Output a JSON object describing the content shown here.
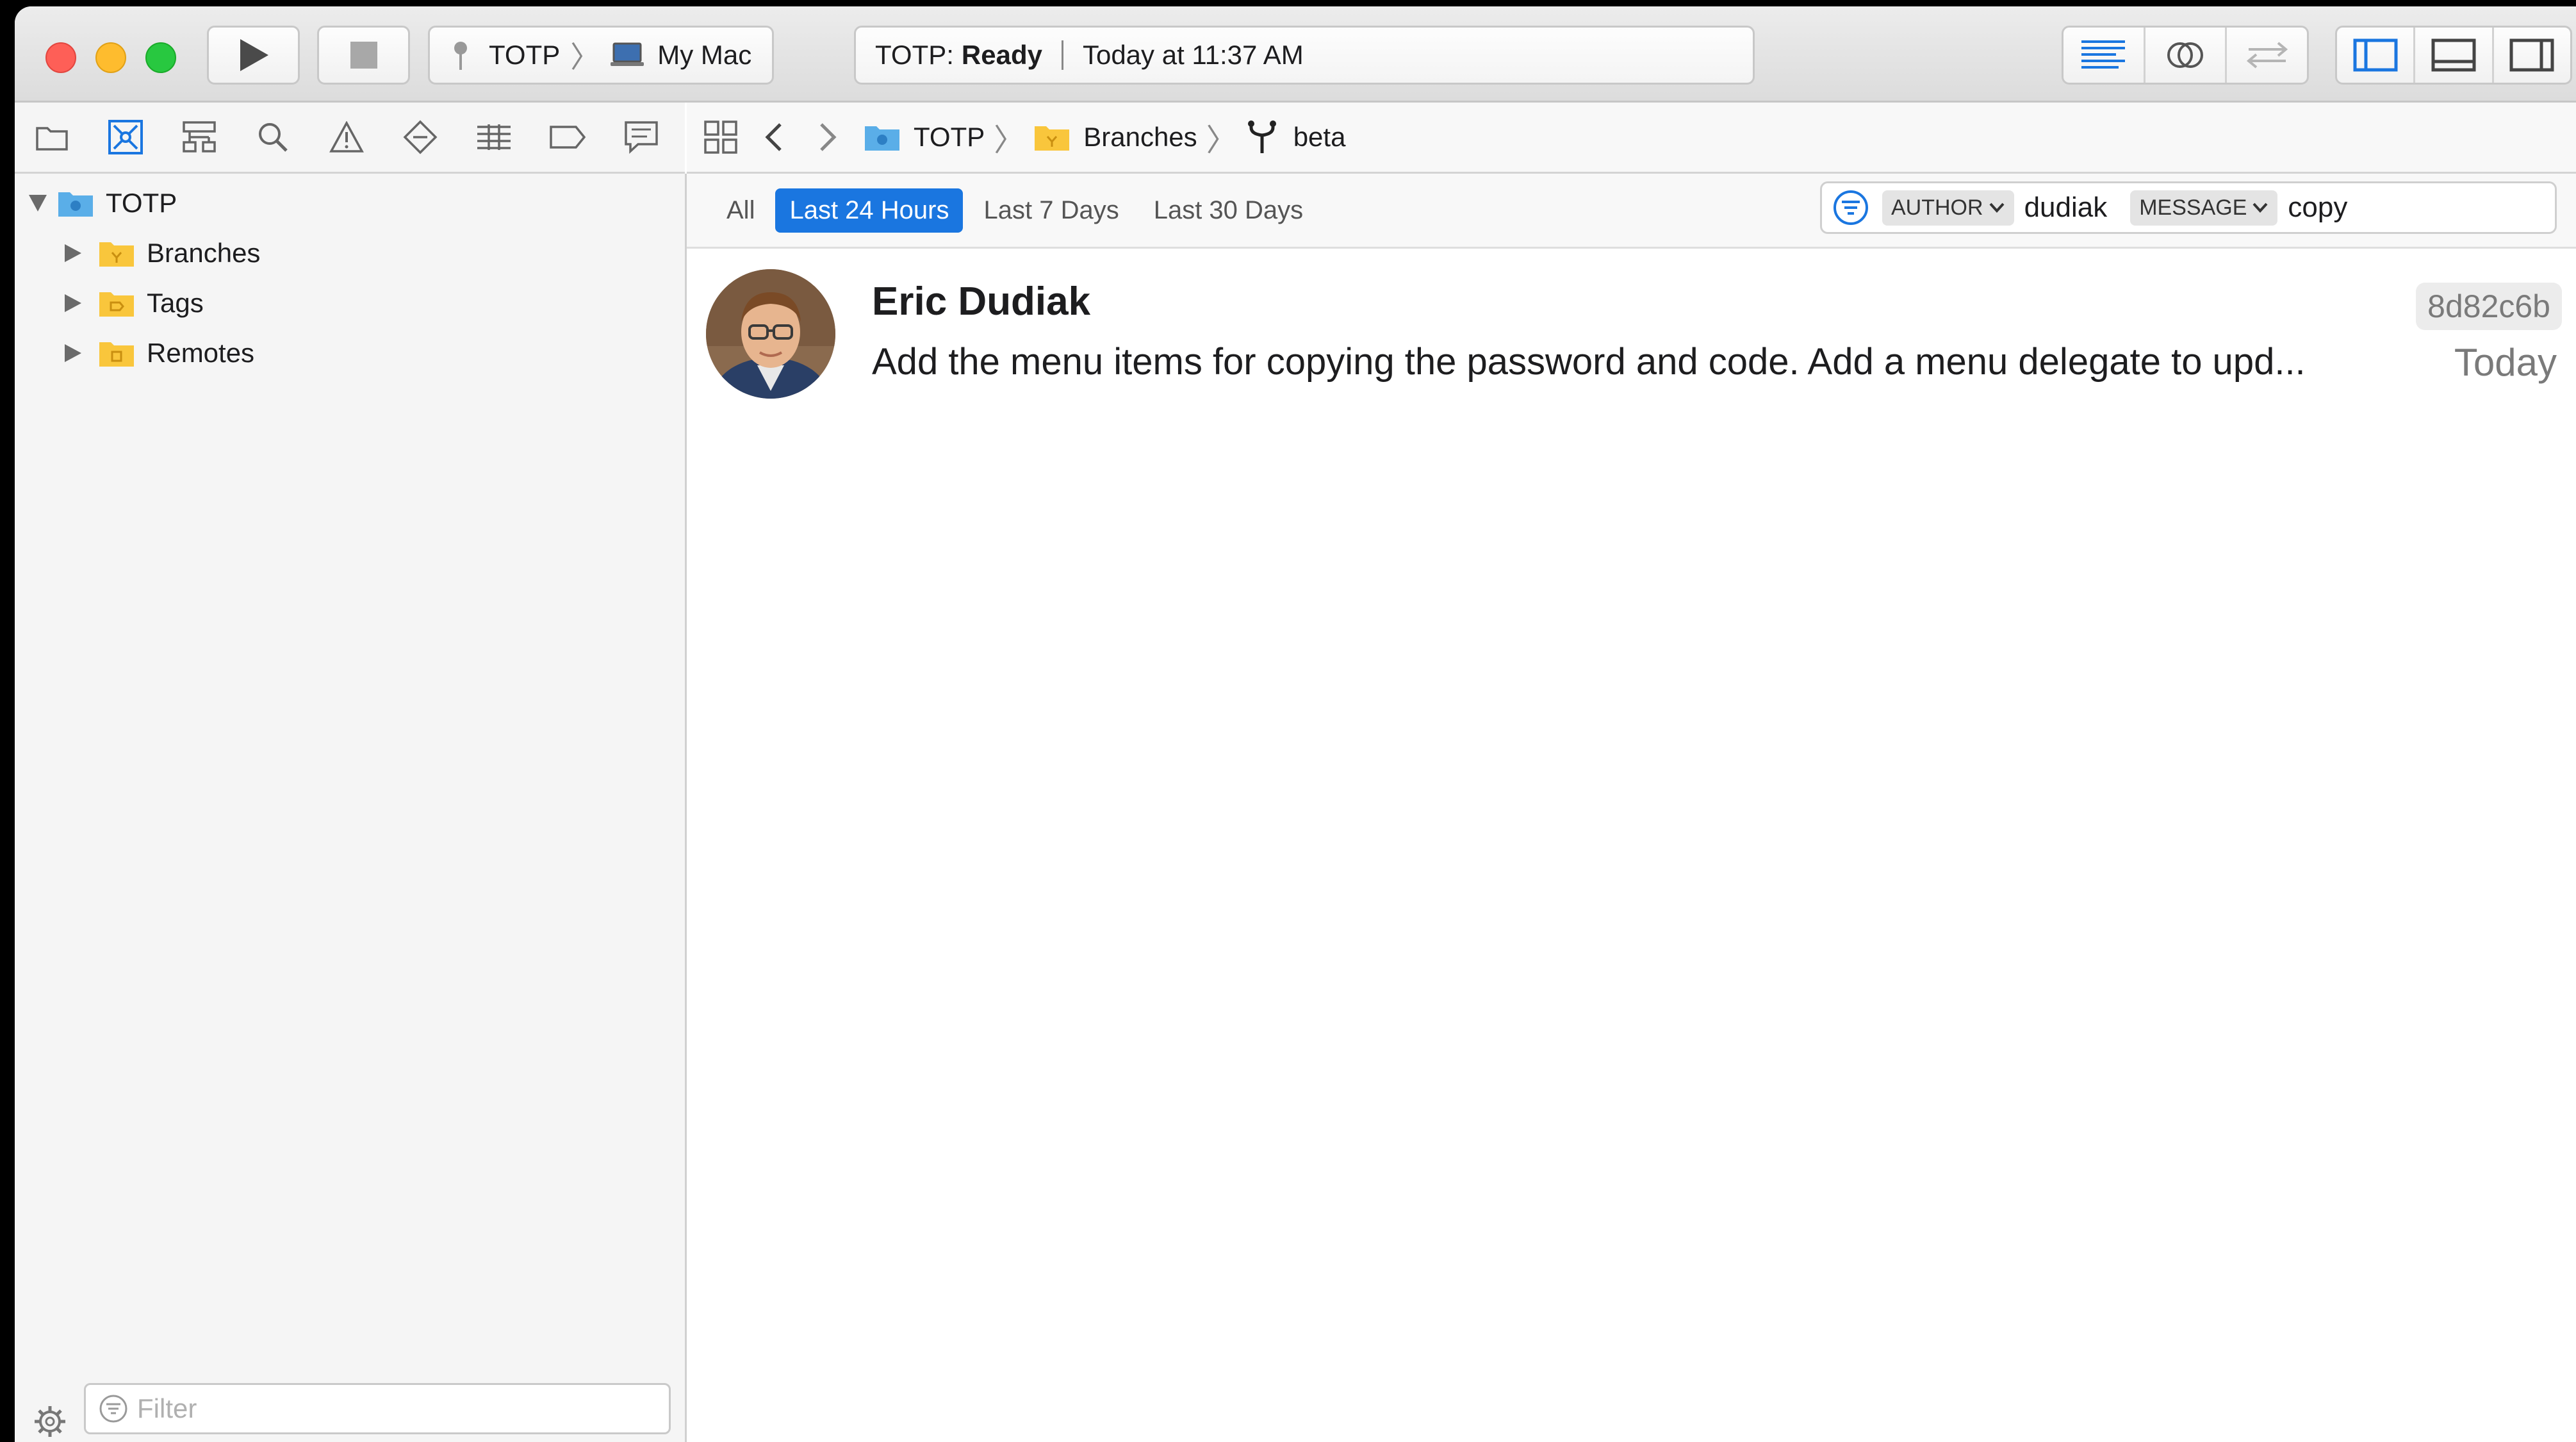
{
  "toolbar": {
    "scheme_name": "TOTP",
    "destination": "My Mac",
    "activity_project": "TOTP:",
    "activity_status": "Ready",
    "activity_time": "Today at 11:37 AM"
  },
  "navigator": {
    "root": "TOTP",
    "items": [
      {
        "label": "Branches"
      },
      {
        "label": "Tags"
      },
      {
        "label": "Remotes"
      }
    ],
    "filter_placeholder": "Filter"
  },
  "jumpbar": {
    "project": "TOTP",
    "group": "Branches",
    "branch": "beta"
  },
  "filters": {
    "ranges": [
      "All",
      "Last 24 Hours",
      "Last 7 Days",
      "Last 30 Days"
    ],
    "selected": "Last 24 Hours",
    "author_label": "AUTHOR",
    "author_value": "dudiak",
    "message_label": "MESSAGE",
    "message_value": "copy"
  },
  "commits": [
    {
      "author": "Eric Dudiak",
      "sha": "8d82c6b",
      "message": "Add the menu items for copying the password and code. Add a menu delegate to upd...",
      "date": "Today"
    }
  ],
  "colors": {
    "accent": "#1a76e0",
    "folder": "#f9c63c",
    "project_blue": "#5aaee8"
  }
}
